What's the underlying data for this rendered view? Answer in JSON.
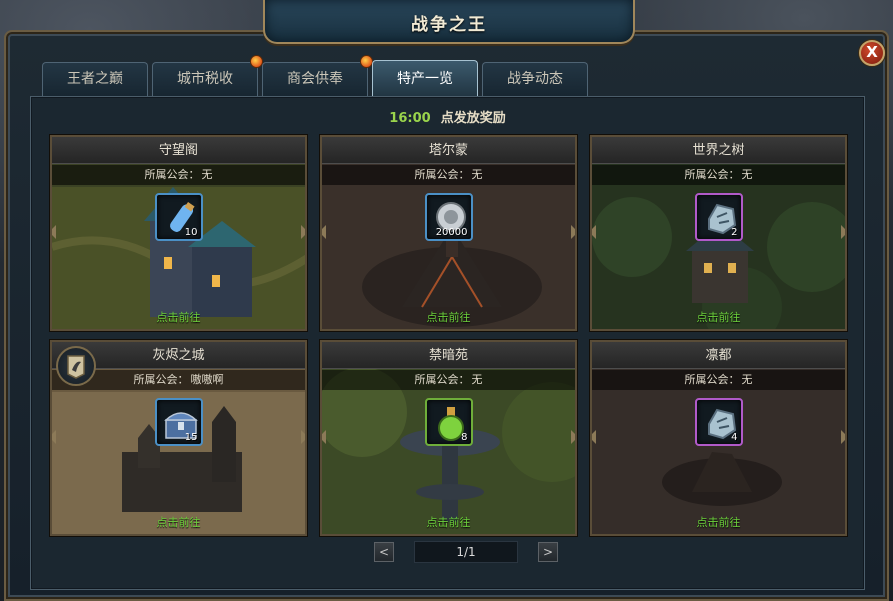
{
  "window": {
    "title": "战争之王",
    "close_label": "X"
  },
  "tabs": [
    {
      "label": "王者之巅",
      "active": false,
      "notify": false
    },
    {
      "label": "城市税收",
      "active": false,
      "notify": true
    },
    {
      "label": "商会供奉",
      "active": false,
      "notify": true
    },
    {
      "label": "特产一览",
      "active": true,
      "notify": false
    },
    {
      "label": "战争动态",
      "active": false,
      "notify": false
    }
  ],
  "header": {
    "time": "16:00",
    "desc": "点发放奖励"
  },
  "guild_key": "所属公会：",
  "go_label": "点击前往",
  "cards": [
    {
      "name": "守望阁",
      "guild": "无",
      "item_icon": "potion-vial-icon",
      "count": "10",
      "rarity": "blue"
    },
    {
      "name": "塔尔蒙",
      "guild": "无",
      "item_icon": "silver-coin-icon",
      "count": "20000",
      "rarity": "blue"
    },
    {
      "name": "世界之树",
      "guild": "无",
      "item_icon": "rune-stone-icon",
      "count": "2",
      "rarity": "purple"
    },
    {
      "name": "灰烬之城",
      "guild": "嗷嗷啊",
      "item_icon": "treasure-chest-icon",
      "count": "15",
      "rarity": "blue"
    },
    {
      "name": "禁暗苑",
      "guild": "无",
      "item_icon": "green-flask-icon",
      "count": "8",
      "rarity": "green"
    },
    {
      "name": "凛都",
      "guild": "无",
      "item_icon": "rune-stone-icon",
      "count": "4",
      "rarity": "purple"
    }
  ],
  "pager": {
    "label": "1/1",
    "prev": "<",
    "next": ">"
  }
}
